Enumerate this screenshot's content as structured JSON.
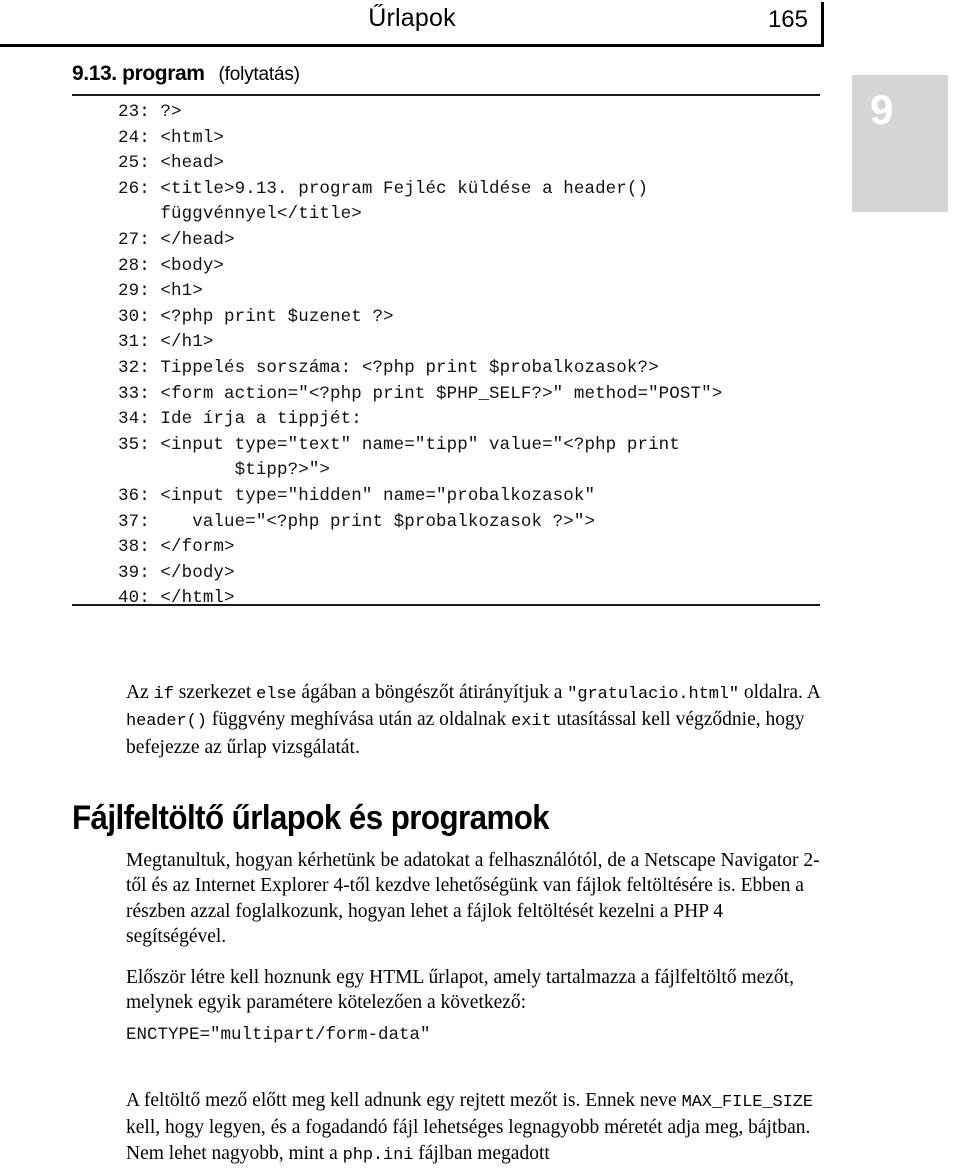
{
  "running_head": {
    "title": "Űrlapok",
    "page_number": "165"
  },
  "chapter_tab": {
    "number": "9",
    "background_color": "#d5d5d5",
    "text_color": "#ffffff"
  },
  "listing": {
    "caption_title": "9.13. program",
    "caption_note": "(folytatás)",
    "lines": [
      "23: ?>",
      "24: <html>",
      "25: <head>",
      "26: <title>9.13. program Fejléc küldése a header()",
      "    függvénnyel</title>",
      "27: </head>",
      "28: <body>",
      "29: <h1>",
      "30: <?php print $uzenet ?>",
      "31: </h1>",
      "32: Tippelés sorszáma: <?php print $probalkozasok?>",
      "33: <form action=\"<?php print $PHP_SELF?>\" method=\"POST\">",
      "34: Ide írja a tippjét:",
      "35: <input type=\"text\" name=\"tipp\" value=\"<?php print",
      "           $tipp?>\">",
      "36: <input type=\"hidden\" name=\"probalkozasok\"",
      "37:    value=\"<?php print $probalkozasok ?>\">",
      "38: </form>",
      "39: </body>",
      "40: </html>"
    ]
  },
  "paragraphs": {
    "p1_seg1": "Az ",
    "p1_code1": "if",
    "p1_seg2": " szerkezet ",
    "p1_code2": "else",
    "p1_seg3": " ágában a böngészőt átirányítjuk a ",
    "p1_code3": "\"gratulacio.html\"",
    "p1_seg4": " oldalra. A ",
    "p1_code4": "header()",
    "p1_seg5": " függvény meghívása után az oldalnak ",
    "p1_code5": "exit",
    "p1_seg6": " utasítással kell végződnie, hogy befejezze az űrlap vizsgálatát.",
    "p2": "Megtanultuk, hogyan kérhetünk be adatokat a felhasználótól, de a Netscape Navigator 2-től és az Internet Explorer 4-től kezdve lehetőségünk van fájlok feltöltésére is. Ebben a részben azzal foglalkozunk, hogyan lehet a fájlok feltöltését kezelni a PHP 4 segítségével.",
    "p3": "Először létre kell hoznunk egy HTML űrlapot, amely tartalmazza a fájlfeltöltő mezőt, melynek egyik paramétere kötelezően a következő:",
    "p4_code": "ENCTYPE=\"multipart/form-data\"",
    "p5_seg1": "A feltöltő mező előtt meg kell adnunk egy rejtett mezőt is. Ennek neve ",
    "p5_code1": "MAX_FILE_SIZE",
    "p5_seg2": " kell, hogy legyen, és a fogadandó fájl lehetséges legnagyobb méretét adja meg, bájtban. Nem lehet nagyobb, mint a ",
    "p5_code2": "php.ini",
    "p5_seg3": " fájlban megadott"
  },
  "section": {
    "heading": "Fájlfeltöltő űrlapok és programok"
  }
}
